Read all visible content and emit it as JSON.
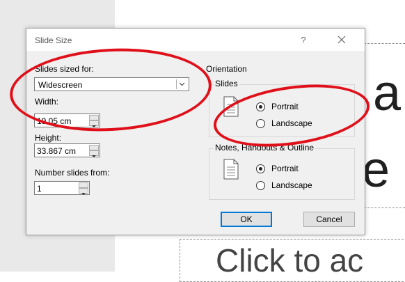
{
  "background": {
    "slide_text_1": "a",
    "slide_text_2": "e",
    "slide_placeholder": "Click to ac"
  },
  "dialog": {
    "title": "Slide Size",
    "help_label": "?",
    "slides_sized_for": {
      "label": "Slides sized for:",
      "selected": "Widescreen"
    },
    "width": {
      "label": "Width:",
      "value": "19.05 cm"
    },
    "height": {
      "label": "Height:",
      "value": "33.867 cm"
    },
    "number_slides_from": {
      "label": "Number slides from:",
      "value": "1"
    },
    "orientation": {
      "label": "Orientation",
      "slides": {
        "label": "Slides",
        "options": [
          "Portrait",
          "Landscape"
        ],
        "selected": "Portrait"
      },
      "notes": {
        "label": "Notes, Handouts & Outline",
        "options": [
          "Portrait",
          "Landscape"
        ],
        "selected": "Portrait"
      }
    },
    "ok_label": "OK",
    "cancel_label": "Cancel"
  },
  "annotation_color": "#e0101a"
}
